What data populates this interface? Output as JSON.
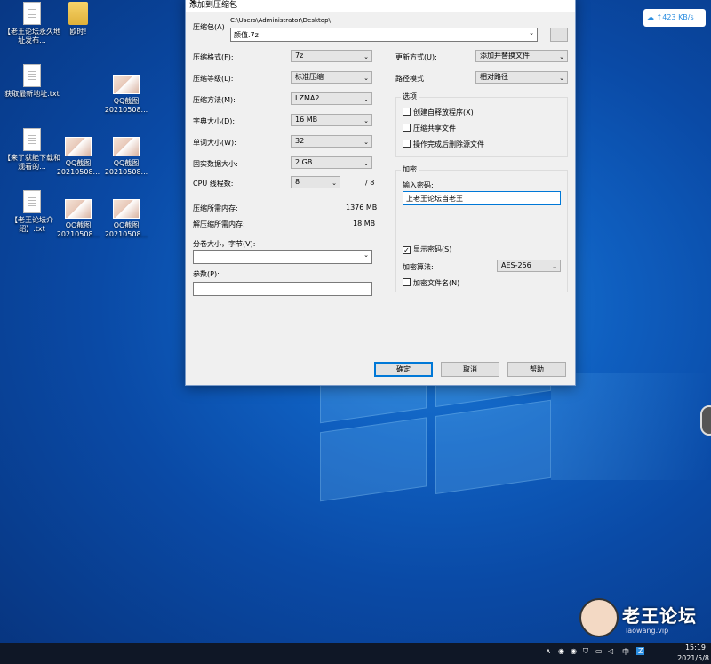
{
  "desktop": {
    "icons": [
      {
        "label": "【老王论坛永久地址发布...",
        "kind": "doc"
      },
      {
        "label": "欧时!",
        "kind": "folder"
      },
      {
        "label": "获取最新地址.txt",
        "kind": "doc"
      },
      {
        "label": "QQ截图20210508...",
        "kind": "thumb"
      },
      {
        "label": "【来了就能下载和观看的...",
        "kind": "doc"
      },
      {
        "label": "QQ截图20210508...",
        "kind": "thumb"
      },
      {
        "label": "QQ截图20210508...",
        "kind": "thumb"
      },
      {
        "label": "【老王论坛介绍】.txt",
        "kind": "doc"
      },
      {
        "label": "QQ截图20210508...",
        "kind": "thumb"
      },
      {
        "label": "QQ截图20210508...",
        "kind": "thumb"
      }
    ]
  },
  "dialog": {
    "title": "添加到压缩包",
    "close": "✕",
    "archive_label": "压缩包(A)",
    "archive_path": "C:\\Users\\Administrator\\Desktop\\",
    "archive_name": "颜值.7z",
    "browse": "...",
    "format_label": "压缩格式(F):",
    "format_value": "7z",
    "level_label": "压缩等级(L):",
    "level_value": "标准压缩",
    "method_label": "压缩方法(M):",
    "method_value": "LZMA2",
    "dict_label": "字典大小(D):",
    "dict_value": "16 MB",
    "word_label": "单词大小(W):",
    "word_value": "32",
    "solid_label": "固实数据大小:",
    "solid_value": "2 GB",
    "cpu_label": "CPU 线程数:",
    "cpu_value": "8",
    "cpu_total": "/ 8",
    "mem_comp_label": "压缩所需内存:",
    "mem_comp_value": "1376 MB",
    "mem_decomp_label": "解压缩所需内存:",
    "mem_decomp_value": "18 MB",
    "split_label": "分卷大小，字节(V):",
    "params_label": "参数(P):",
    "update_label": "更新方式(U):",
    "update_value": "添加并替换文件",
    "path_label": "路径模式",
    "path_value": "相对路径",
    "options_title": "选项",
    "opt_sfx": "创建自释放程序(X)",
    "opt_shared": "压缩共享文件",
    "opt_delete": "操作完成后删除源文件",
    "enc_title": "加密",
    "enc_pwd_label": "输入密码:",
    "enc_pwd_value": "上老王论坛当老王",
    "enc_show": "显示密码(S)",
    "enc_method_label": "加密算法:",
    "enc_method_value": "AES-256",
    "enc_names": "加密文件名(N)",
    "ok": "确定",
    "cancel": "取消",
    "help": "帮助"
  },
  "netspeed": "↑423 KB/s",
  "watermark": {
    "text": "老王论坛",
    "sub": "laowang.vip"
  },
  "tray": {
    "ime": "中",
    "time": "15:19",
    "date": "2021/5/8"
  }
}
